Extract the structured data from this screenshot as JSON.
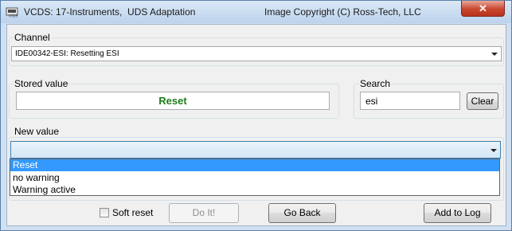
{
  "window": {
    "title": "VCDS: 17-Instruments,  UDS Adaptation",
    "copyright": "Image Copyright (C) Ross-Tech, LLC",
    "close_glyph": "✕"
  },
  "channel": {
    "label": "Channel",
    "selected": "IDE00342-ESI: Resetting ESI"
  },
  "stored_value": {
    "label": "Stored value",
    "value": "Reset",
    "value_color": "#1e7d1e"
  },
  "search": {
    "label": "Search",
    "value": "esi",
    "clear_label": "Clear"
  },
  "new_value": {
    "label": "New value",
    "selected": "",
    "options": [
      "Reset",
      "no warning",
      "Warning active"
    ],
    "highlighted_index": 0
  },
  "footer": {
    "soft_reset_label": "Soft reset",
    "soft_reset_checked": false,
    "do_it_label": "Do It!",
    "go_back_label": "Go Back",
    "add_to_log_label": "Add to Log"
  },
  "colors": {
    "selection": "#3399ff",
    "accent_border": "#3c7fb1"
  }
}
